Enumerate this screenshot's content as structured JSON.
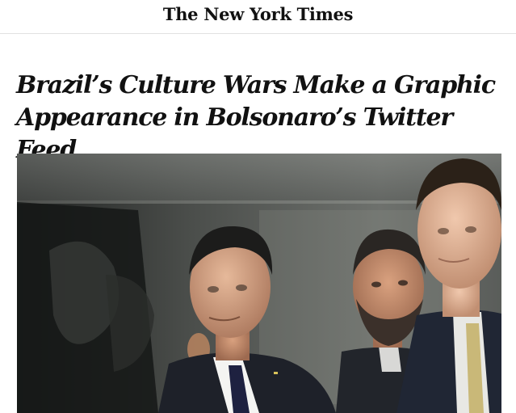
{
  "masthead": {
    "logo_text": "The New York Times"
  },
  "article": {
    "headline": "Brazil’s Culture Wars Make a Graphic Appearance in Bolsonaro’s Twitter Feed"
  },
  "lead_image": {
    "subject": "news-photo"
  },
  "colors": {
    "text": "#111111",
    "divider": "#e2e2e2",
    "background": "#ffffff"
  }
}
